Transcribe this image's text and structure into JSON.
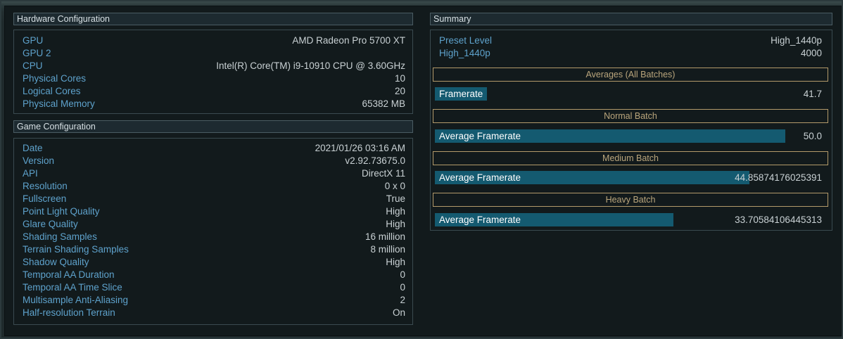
{
  "hardware": {
    "title": "Hardware Configuration",
    "rows": [
      {
        "label": "GPU",
        "value": "AMD Radeon Pro 5700 XT"
      },
      {
        "label": "GPU 2",
        "value": ""
      },
      {
        "label": "CPU",
        "value": "Intel(R) Core(TM) i9-10910 CPU @ 3.60GHz"
      },
      {
        "label": "Physical Cores",
        "value": "10"
      },
      {
        "label": "Logical Cores",
        "value": "20"
      },
      {
        "label": "Physical Memory",
        "value": "65382 MB"
      }
    ]
  },
  "game": {
    "title": "Game Configuration",
    "rows": [
      {
        "label": "Date",
        "value": "2021/01/26 03:16 AM"
      },
      {
        "label": "Version",
        "value": "v2.92.73675.0"
      },
      {
        "label": "API",
        "value": "DirectX 11"
      },
      {
        "label": "Resolution",
        "value": "0 x 0"
      },
      {
        "label": "Fullscreen",
        "value": "True"
      },
      {
        "label": "Point Light Quality",
        "value": "High"
      },
      {
        "label": "Glare Quality",
        "value": "High"
      },
      {
        "label": "Shading Samples",
        "value": "16 million"
      },
      {
        "label": "Terrain Shading Samples",
        "value": "8 million"
      },
      {
        "label": "Shadow Quality",
        "value": "High"
      },
      {
        "label": "Temporal AA Duration",
        "value": "0"
      },
      {
        "label": "Temporal AA Time Slice",
        "value": "0"
      },
      {
        "label": "Multisample Anti-Aliasing",
        "value": "2"
      },
      {
        "label": "Half-resolution Terrain",
        "value": "On"
      }
    ]
  },
  "summary": {
    "title": "Summary",
    "preset_label": "Preset Level",
    "preset_value": "High_1440p",
    "score_label": "High_1440p",
    "score_value": "4000",
    "averages": {
      "heading": "Averages (All Batches)",
      "label": "Framerate",
      "value": "41.7",
      "fill": 0.134
    },
    "batches": [
      {
        "heading": "Normal Batch",
        "label": "Average Framerate",
        "value": "50.0",
        "fill": 0.902
      },
      {
        "heading": "Medium Batch",
        "label": "Average Framerate",
        "value": "44.8587417602539​1",
        "display": "44.85874176025391",
        "fill": 0.81
      },
      {
        "heading": "Heavy Batch",
        "label": "Average Framerate",
        "value": "33.70584106445313",
        "fill": 0.614
      }
    ]
  },
  "colors": {
    "label_blue": "#5ea2cc",
    "value_gray": "#c9d1d4",
    "bar_teal": "#145a70",
    "batch_border": "#b39a6a"
  }
}
